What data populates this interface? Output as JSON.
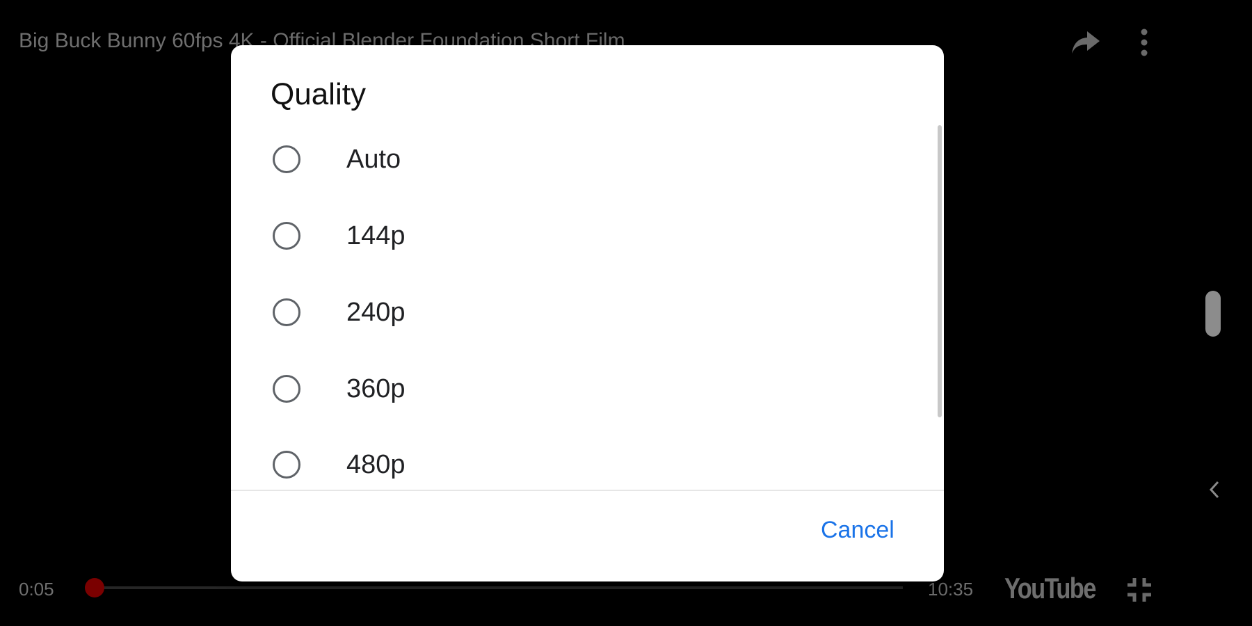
{
  "player": {
    "video_title": "Big Buck Bunny 60fps 4K - Official Blender Foundation Short Film",
    "current_time": "0:05",
    "total_time": "10:35",
    "progress_fraction": 0.008,
    "logo_text": "YouTube",
    "icons": {
      "share": "share-icon",
      "more": "more-vert-icon",
      "chevron": "chevron-left-icon",
      "exit_fullscreen": "exit-fullscreen-icon"
    },
    "colors": {
      "progress_played": "#6b0000",
      "progress_thumb": "#7a0000"
    }
  },
  "dialog": {
    "title": "Quality",
    "options": [
      {
        "label": "Auto",
        "selected": false
      },
      {
        "label": "144p",
        "selected": false
      },
      {
        "label": "240p",
        "selected": false
      },
      {
        "label": "360p",
        "selected": false
      },
      {
        "label": "480p",
        "selected": false
      }
    ],
    "cancel_label": "Cancel",
    "accent_color": "#1a73e8"
  }
}
